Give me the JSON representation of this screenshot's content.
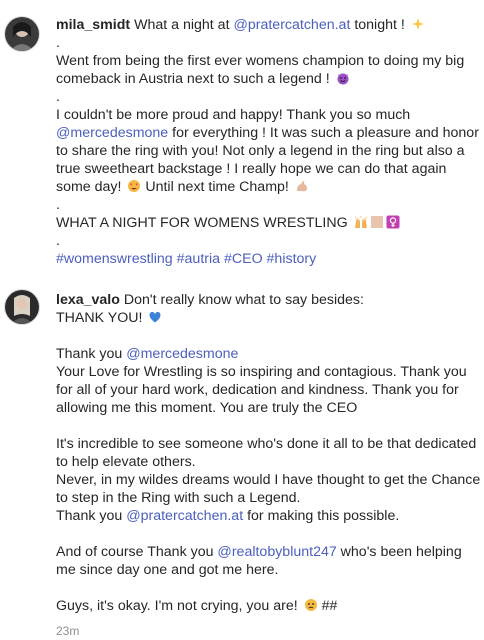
{
  "comment1": {
    "username": "mila_smidt",
    "lines": [
      {
        "parts": [
          {
            "t": "What a night at "
          },
          {
            "t": "@pratercatchen.at",
            "link": true
          },
          {
            "t": " tonight ! "
          }
        ],
        "emoji": [
          "sparkles"
        ]
      },
      {
        "parts": [
          {
            "t": "."
          }
        ]
      },
      {
        "parts": [
          {
            "t": "Went from being the first ever womens champion to doing my big"
          }
        ]
      },
      {
        "parts": [
          {
            "t": "comeback in Austria next to such a legend ! "
          }
        ],
        "emoji": [
          "smiling-devil"
        ]
      },
      {
        "parts": [
          {
            "t": "."
          }
        ]
      },
      {
        "parts": [
          {
            "t": "I couldn't be more proud and happy! Thank you so much"
          }
        ]
      },
      {
        "parts": [
          {
            "t": "@mercedesmone",
            "link": true
          },
          {
            "t": " for everything ! It was such a pleasure and honor"
          }
        ]
      },
      {
        "parts": [
          {
            "t": "to share the ring with you! Not only a legend in the ring but also a"
          }
        ]
      },
      {
        "parts": [
          {
            "t": "true sweetheart backstage ! I really hope we can do that again"
          }
        ]
      },
      {
        "parts": [
          {
            "t": "some day! "
          }
        ],
        "emoji": [
          "heart-eyes"
        ],
        "after": " Until next time Champ! ",
        "emoji2": [
          "flexed-biceps"
        ]
      },
      {
        "parts": [
          {
            "t": "."
          }
        ]
      },
      {
        "parts": [
          {
            "t": "WHAT A NIGHT FOR WOMENS WRESTLING "
          }
        ],
        "emoji": [
          "raising-hands",
          "skin-tone",
          "female-sign"
        ]
      },
      {
        "parts": [
          {
            "t": "."
          }
        ]
      },
      {
        "parts": [
          {
            "t": "#womenswrestling #autria #CEO #history",
            "link": true
          }
        ]
      }
    ]
  },
  "comment2": {
    "username": "lexa_valo",
    "lines": [
      {
        "parts": [
          {
            "t": "Don't really know what to say besides:"
          }
        ]
      },
      {
        "parts": [
          {
            "t": "THANK YOU! "
          }
        ],
        "emoji": [
          "blue-heart"
        ]
      },
      {
        "gap": true
      },
      {
        "parts": [
          {
            "t": "Thank you "
          },
          {
            "t": "@mercedesmone",
            "link": true
          }
        ]
      },
      {
        "parts": [
          {
            "t": "Your Love for Wrestling is so inspiring and contagious. Thank you"
          }
        ]
      },
      {
        "parts": [
          {
            "t": "for all of your hard work, dedication and kindness. Thank you for"
          }
        ]
      },
      {
        "parts": [
          {
            "t": "allowing me this moment. You are truly the CEO"
          }
        ]
      },
      {
        "gap": true
      },
      {
        "parts": [
          {
            "t": "It's incredible to see someone who's done it all to be that dedicated"
          }
        ]
      },
      {
        "parts": [
          {
            "t": "to help elevate others."
          }
        ]
      },
      {
        "parts": [
          {
            "t": "Never, in my wildes dreams would I have thought to get the Chance"
          }
        ]
      },
      {
        "parts": [
          {
            "t": "to step in the Ring with such a Legend."
          }
        ]
      },
      {
        "parts": [
          {
            "t": "Thank you "
          },
          {
            "t": "@pratercatchen.at",
            "link": true
          },
          {
            "t": " for making this possible."
          }
        ]
      },
      {
        "gap": true
      },
      {
        "parts": [
          {
            "t": "And of course Thank you "
          },
          {
            "t": "@realtobyblunt247",
            "link": true
          },
          {
            "t": " who's been helping"
          }
        ]
      },
      {
        "parts": [
          {
            "t": "me since day one and got me here."
          }
        ]
      },
      {
        "gap": true
      },
      {
        "parts": [
          {
            "t": "Guys, it's okay. I'm not crying, you are! "
          }
        ],
        "emoji": [
          "teary-face"
        ],
        "after": " ##"
      }
    ],
    "timestamp": "23m"
  },
  "colors": {
    "link": "#4b5fbd",
    "text": "#262626",
    "muted": "#8e8e8e"
  }
}
